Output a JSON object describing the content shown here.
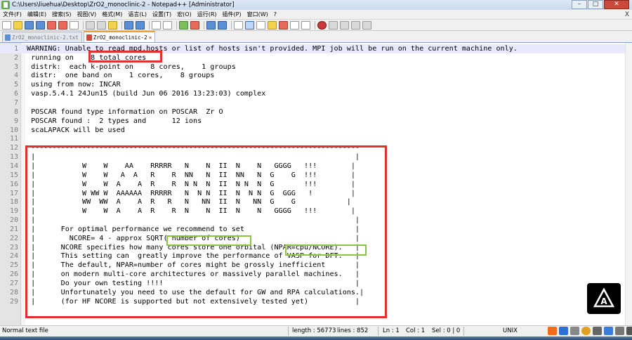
{
  "window": {
    "title": "C:\\Users\\liuehua\\Desktop\\ZrO2_monoclinic-2 - Notepad++ [Administrator]",
    "minimize": "–",
    "maximize": "□",
    "close": "✕"
  },
  "menu": {
    "items": [
      "文件(F)",
      "编辑(E)",
      "搜索(S)",
      "视图(V)",
      "格式(M)",
      "语言(L)",
      "设置(T)",
      "宏(O)",
      "运行(R)",
      "插件(P)",
      "窗口(W)",
      "?"
    ],
    "close": "X"
  },
  "tabs": [
    {
      "label": "ZrO2_monoclinic-2.txt",
      "active": false
    },
    {
      "label": "ZrO2_monoclinic-2",
      "active": true
    }
  ],
  "editor": {
    "lines": [
      "WARNING: Unable to read mpd.hosts or list of hosts isn't provided. MPI job will be run on the current machine only.",
      " running on    8 total cores",
      " distrk:  each k-point on    8 cores,    1 groups",
      " distr:  one band on    1 cores,    8 groups",
      " using from now: INCAR",
      " vasp.5.4.1 24Jun15 (build Jun 06 2016 13:23:03) complex",
      "",
      " POSCAR found type information on POSCAR  Zr O",
      " POSCAR found :  2 types and      12 ions",
      " scaLAPACK will be used",
      "",
      " -----------------------------------------------------------------------------",
      " |                                                                           |",
      " |           W    W    AA    RRRRR   N    N  II  N    N   GGGG   !!!        |",
      " |           W    W   A  A   R    R  NN   N  II  NN   N  G    G  !!!        |",
      " |           W    W  A    A  R    R  N N  N  II  N N  N  G       !!!        |",
      " |           W WW W  AAAAAA  RRRRR   N  N N  II  N  N N  G  GGG   !         |",
      " |           WW  WW  A    A  R   R   N   NN  II  N   NN  G    G            |",
      " |           W    W  A    A  R    R  N    N  II  N    N   GGGG   !!!        |",
      " |                                                                           |",
      " |      For optimal performance we recommend to set                          |",
      " |        NCORE= 4 - approx SQRT( number of cores)                           |",
      " |      NCORE specifies how many cores store one orbital (NPAR=cpu/NCORE).   |",
      " |      This setting can  greatly improve the performance of VASP for DFT.   |",
      " |      The default, NPAR=number of cores might be grossly inefficient       |",
      " |      on modern multi-core architectures or massively parallel machines.   |",
      " |      Do your own testing !!!!                                             |",
      " |      Unfortunately you need to use the default for GW and RPA calculations.|",
      " |      (for HF NCORE is supported but not extensively tested yet)           |"
    ]
  },
  "status": {
    "type": "Normal text file",
    "length": "length : 56773",
    "lines": "lines : 852",
    "ln": "Ln : 1",
    "col": "Col : 1",
    "sel": "Sel : 0 | 0",
    "eol": "UNIX"
  },
  "colors": {
    "highlight_red": "#e03030",
    "highlight_green": "#8cc63f"
  }
}
